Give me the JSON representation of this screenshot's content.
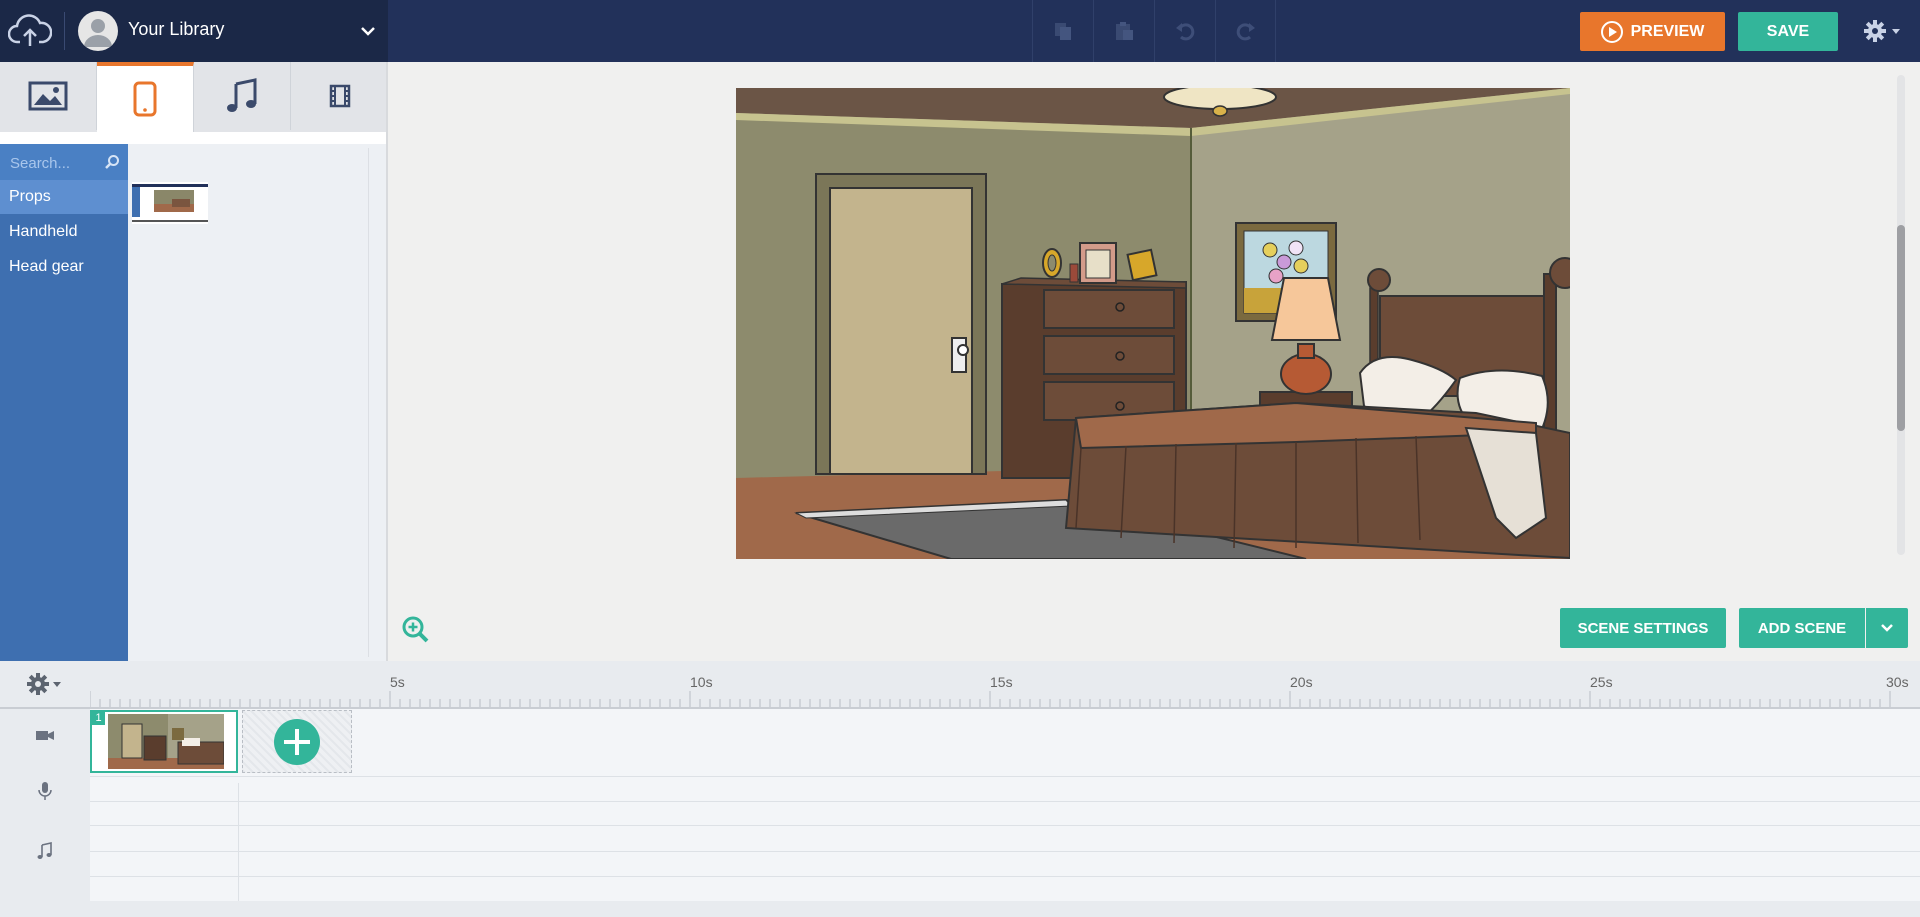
{
  "topbar": {
    "library_label": "Your Library",
    "preview_label": "PREVIEW",
    "save_label": "SAVE"
  },
  "left_panel": {
    "tabs": [
      "scenes",
      "props",
      "music",
      "video"
    ],
    "active_tab": "props",
    "search_placeholder": "Search...",
    "categories": [
      "Props",
      "Handheld",
      "Head gear"
    ],
    "selected_category": "Props"
  },
  "stage": {
    "scene_settings_label": "SCENE SETTINGS",
    "add_scene_label": "ADD SCENE"
  },
  "timeline": {
    "ticks": [
      "5s",
      "10s",
      "15s",
      "20s",
      "25s",
      "30s"
    ],
    "scene_number": "1",
    "tracks": [
      "camera-icon",
      "microphone-icon",
      "music-note-icon"
    ]
  },
  "colors": {
    "topbar": "#22315a",
    "accent_orange": "#e8762c",
    "accent_teal": "#33b59a",
    "category_panel": "#3e6fb0"
  }
}
